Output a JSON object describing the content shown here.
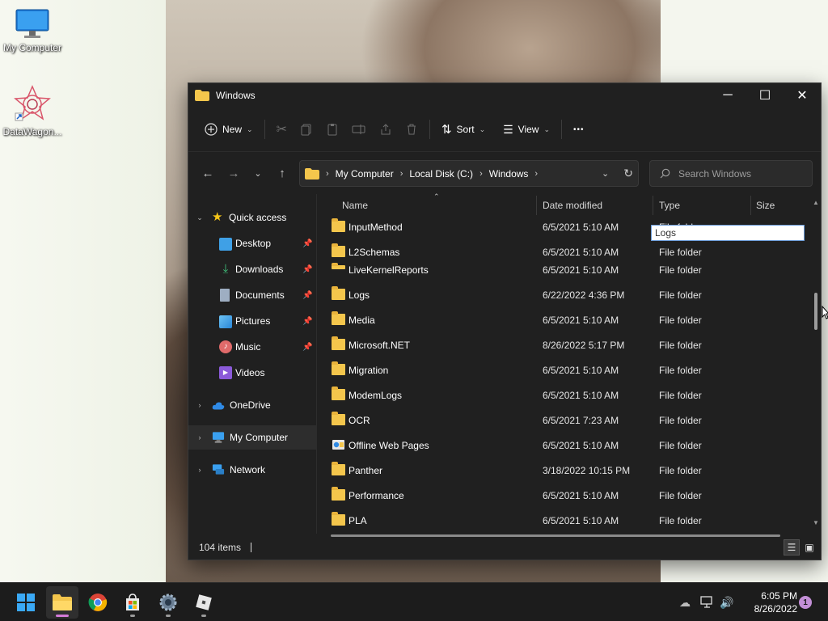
{
  "desktop": {
    "icons": [
      {
        "label": "My Computer",
        "icon": "monitor-icon"
      },
      {
        "label": "DataWagon...",
        "icon": "datawagon-icon"
      }
    ]
  },
  "window": {
    "title": "Windows",
    "controls": {
      "minimize": "─",
      "maximize": "☐",
      "close": "✕"
    }
  },
  "toolbar": {
    "new_label": "New",
    "sort_label": "Sort",
    "view_label": "View",
    "more_label": "•••"
  },
  "address": {
    "crumbs": [
      "My Computer",
      "Local Disk (C:)",
      "Windows"
    ],
    "search_placeholder": "Search Windows"
  },
  "sidebar": {
    "items": [
      {
        "label": "Quick access",
        "icon": "star-icon"
      },
      {
        "label": "Desktop",
        "icon": "desktop-icon",
        "pinned": true
      },
      {
        "label": "Downloads",
        "icon": "download-icon",
        "pinned": true
      },
      {
        "label": "Documents",
        "icon": "documents-icon",
        "pinned": true
      },
      {
        "label": "Pictures",
        "icon": "pictures-icon",
        "pinned": true
      },
      {
        "label": "Music",
        "icon": "music-icon",
        "pinned": true
      },
      {
        "label": "Videos",
        "icon": "videos-icon"
      },
      {
        "label": "OneDrive",
        "icon": "cloud-icon"
      },
      {
        "label": "My Computer",
        "icon": "computer-icon",
        "selected": true
      },
      {
        "label": "Network",
        "icon": "network-icon"
      }
    ]
  },
  "columns": {
    "name": "Name",
    "date": "Date modified",
    "type": "Type",
    "size": "Size"
  },
  "rename_value": "Logs",
  "files": [
    {
      "name": "InputMethod",
      "date": "6/5/2021 5:10 AM",
      "type": "File folder"
    },
    {
      "name": "L2Schemas",
      "date": "6/5/2021 5:10 AM",
      "type": "File folder"
    },
    {
      "name": "LiveKernelReports",
      "date": "6/5/2021 5:10 AM",
      "type": "File folder"
    },
    {
      "name": "Logs",
      "date": "6/22/2022 4:36 PM",
      "type": "File folder"
    },
    {
      "name": "Media",
      "date": "6/5/2021 5:10 AM",
      "type": "File folder"
    },
    {
      "name": "Microsoft.NET",
      "date": "8/26/2022 5:17 PM",
      "type": "File folder"
    },
    {
      "name": "Migration",
      "date": "6/5/2021 5:10 AM",
      "type": "File folder"
    },
    {
      "name": "ModemLogs",
      "date": "6/5/2021 5:10 AM",
      "type": "File folder"
    },
    {
      "name": "OCR",
      "date": "6/5/2021 7:23 AM",
      "type": "File folder"
    },
    {
      "name": "Offline Web Pages",
      "date": "6/5/2021 5:10 AM",
      "type": "File folder",
      "icon": "offline-pages-icon"
    },
    {
      "name": "Panther",
      "date": "3/18/2022 10:15 PM",
      "type": "File folder"
    },
    {
      "name": "Performance",
      "date": "6/5/2021 5:10 AM",
      "type": "File folder"
    },
    {
      "name": "PLA",
      "date": "6/5/2021 5:10 AM",
      "type": "File folder"
    }
  ],
  "status": {
    "items_count": "104 items"
  },
  "taskbar": {
    "apps": [
      "start-icon",
      "file-explorer-icon",
      "chrome-icon",
      "store-icon",
      "settings-icon",
      "roblox-icon"
    ],
    "time": "6:05 PM",
    "date": "8/26/2022",
    "notifications": "1"
  }
}
